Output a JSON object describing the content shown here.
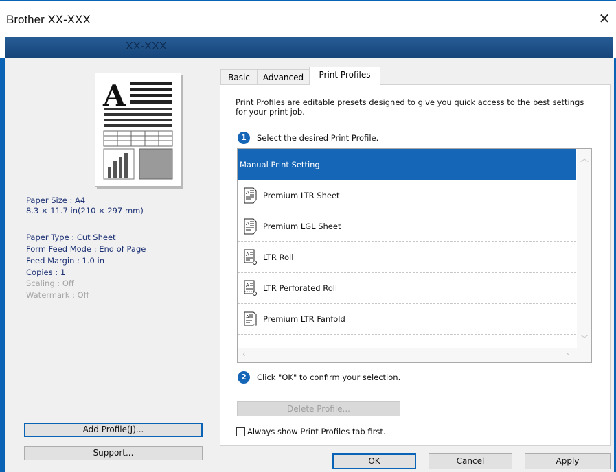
{
  "window": {
    "title": "Brother XX-XXX",
    "model_banner": "XX-XXX"
  },
  "paper_info": [
    {
      "text": "Paper Size : A4",
      "enabled": true
    },
    {
      "text": "8.3 × 11.7 in(210 × 297 mm)",
      "enabled": true
    },
    {
      "text": "Paper Type : Cut Sheet",
      "enabled": true
    },
    {
      "text": "Form Feed Mode : End of Page",
      "enabled": true
    },
    {
      "text": "Feed Margin : 1.0 in",
      "enabled": true
    },
    {
      "text": "Copies : 1",
      "enabled": true
    },
    {
      "text": "Scaling : Off",
      "enabled": false
    },
    {
      "text": "Watermark : Off",
      "enabled": false
    }
  ],
  "left_buttons": {
    "add_profile": "Add Profile(J)...",
    "support": "Support..."
  },
  "tabs": [
    {
      "label": "Basic",
      "active": false
    },
    {
      "label": "Advanced",
      "active": false
    },
    {
      "label": "Print Profiles",
      "active": true
    }
  ],
  "profiles_tab": {
    "description": "Print Profiles are editable presets designed to give you quick access to the best settings for your print job.",
    "step1": {
      "number": "1",
      "text": "Select the desired Print Profile."
    },
    "profiles": [
      {
        "label": "Manual Print Setting",
        "selected": true,
        "icon": "none"
      },
      {
        "label": "Premium LTR Sheet",
        "selected": false,
        "icon": "sheet-icon"
      },
      {
        "label": "Premium LGL Sheet",
        "selected": false,
        "icon": "sheet-icon"
      },
      {
        "label": "LTR Roll",
        "selected": false,
        "icon": "roll-icon"
      },
      {
        "label": "LTR Perforated Roll",
        "selected": false,
        "icon": "perforated-roll-icon"
      },
      {
        "label": "Premium LTR Fanfold",
        "selected": false,
        "icon": "fanfold-icon"
      }
    ],
    "step2": {
      "number": "2",
      "text": "Click \"OK\" to confirm your selection."
    },
    "delete_button": "Delete Profile...",
    "always_show_checkbox": {
      "label": "Always show Print Profiles tab first.",
      "checked": false
    }
  },
  "dialog_buttons": {
    "ok": "OK",
    "cancel": "Cancel",
    "apply": "Apply"
  },
  "colors": {
    "accent": "#0b63b6",
    "selection": "#1666b7",
    "banner": "#1f5288",
    "info_text": "#1b2f73"
  }
}
